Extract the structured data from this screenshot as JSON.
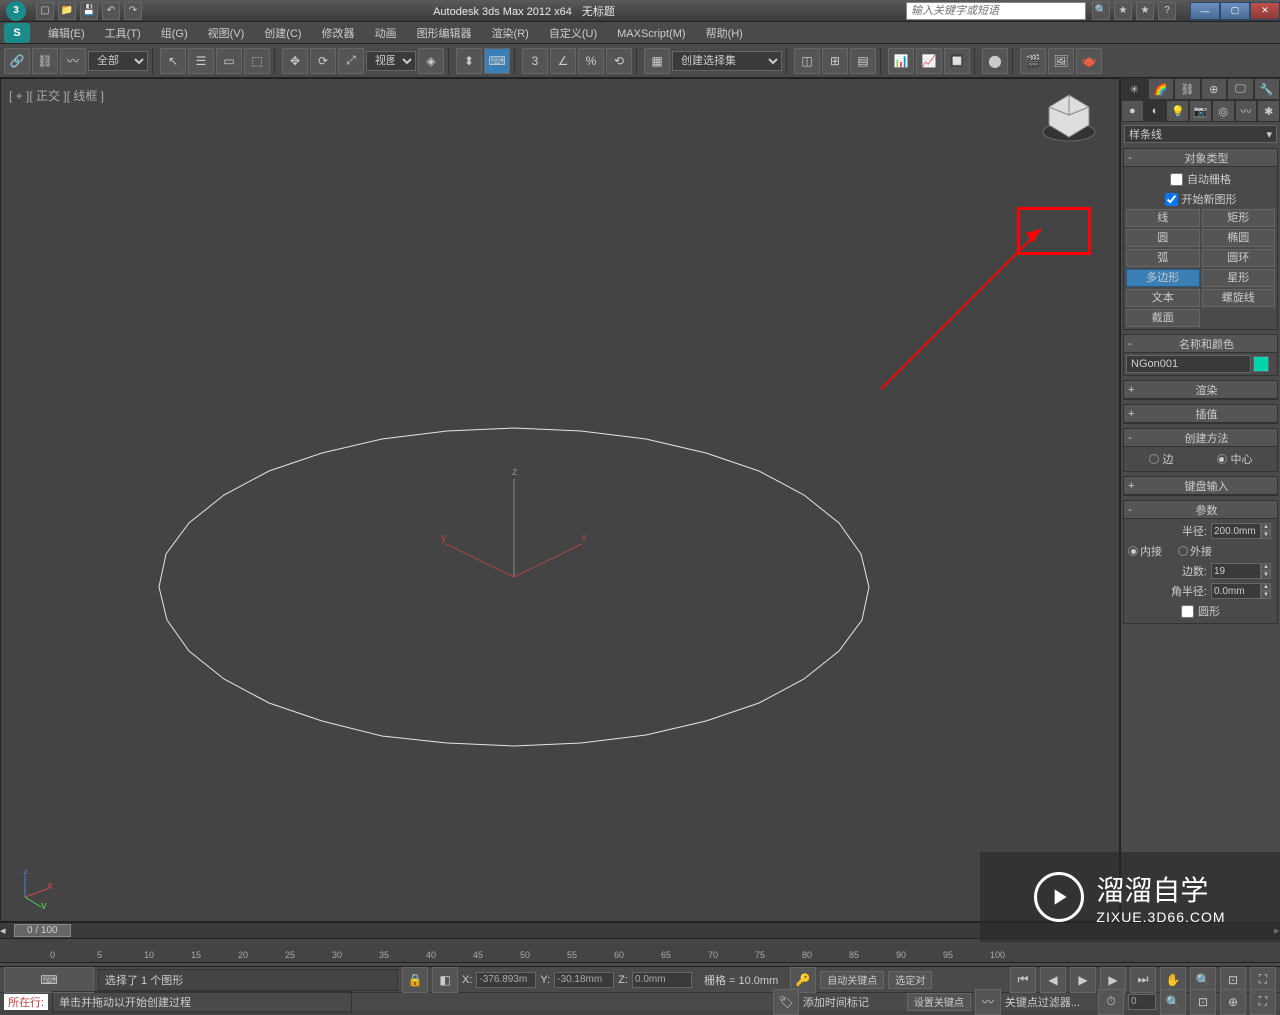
{
  "titlebar": {
    "app_title": "Autodesk 3ds Max  2012 x64",
    "doc_title": "无标题",
    "search_placeholder": "输入关键字或短语"
  },
  "menubar": {
    "items": [
      "编辑(E)",
      "工具(T)",
      "组(G)",
      "视图(V)",
      "创建(C)",
      "修改器",
      "动画",
      "图形编辑器",
      "渲染(R)",
      "自定义(U)",
      "MAXScript(M)",
      "帮助(H)"
    ]
  },
  "toolbar": {
    "filter_label": "全部",
    "view_label": "视图",
    "set_label": "创建选择集"
  },
  "viewport": {
    "label": "[ + ][ 正交 ][ 线框 ]",
    "gizmo": {
      "x": "x",
      "y": "y",
      "z": "z"
    }
  },
  "cmd_panel": {
    "spline_dropdown": "样条线",
    "rollouts": {
      "object_type": {
        "title": "对象类型",
        "auto_grid": "自动栅格",
        "start_new": "开始新图形",
        "buttons": [
          [
            "线",
            "矩形"
          ],
          [
            "圆",
            "椭圆"
          ],
          [
            "弧",
            "圆环"
          ],
          [
            "多边形",
            "星形"
          ],
          [
            "文本",
            "螺旋线"
          ],
          [
            "截面",
            ""
          ]
        ],
        "active": "多边形"
      },
      "name_color": {
        "title": "名称和颜色",
        "name": "NGon001"
      },
      "render": {
        "title": "渲染"
      },
      "interp": {
        "title": "插值"
      },
      "create_method": {
        "title": "创建方法",
        "edge": "边",
        "center": "中心"
      },
      "keyboard": {
        "title": "键盘输入"
      },
      "params": {
        "title": "参数",
        "radius_label": "半径:",
        "radius_value": "200.0mm",
        "inscribed": "内接",
        "circumscribed": "外接",
        "sides_label": "边数:",
        "sides_value": "19",
        "corner_label": "角半径:",
        "corner_value": "0.0mm",
        "circular": "圆形"
      }
    }
  },
  "timeline": {
    "slider": "0 / 100",
    "ticks": [
      0,
      5,
      10,
      15,
      20,
      25,
      30,
      35,
      40,
      45,
      50,
      55,
      60,
      65,
      70,
      75,
      80,
      85,
      90,
      95,
      100
    ]
  },
  "statusbar": {
    "selected": "选择了 1 个图形",
    "x_label": "X:",
    "x_val": "-376.893m",
    "y_label": "Y:",
    "y_val": "-30.18mm",
    "z_label": "Z:",
    "z_val": "0.0mm",
    "grid": "栅格 = 10.0mm",
    "auto_key": "自动关键点",
    "selected_obj": "选定对",
    "set_key": "设置关键点",
    "key_filter": "关键点过滤器...",
    "prompt": "单击并拖动以开始创建过程",
    "add_time": "添加时间标记",
    "now_line_label": "所在行:"
  },
  "watermark": {
    "brand": "溜溜自学",
    "url": "ZIXUE.3D66.COM"
  }
}
